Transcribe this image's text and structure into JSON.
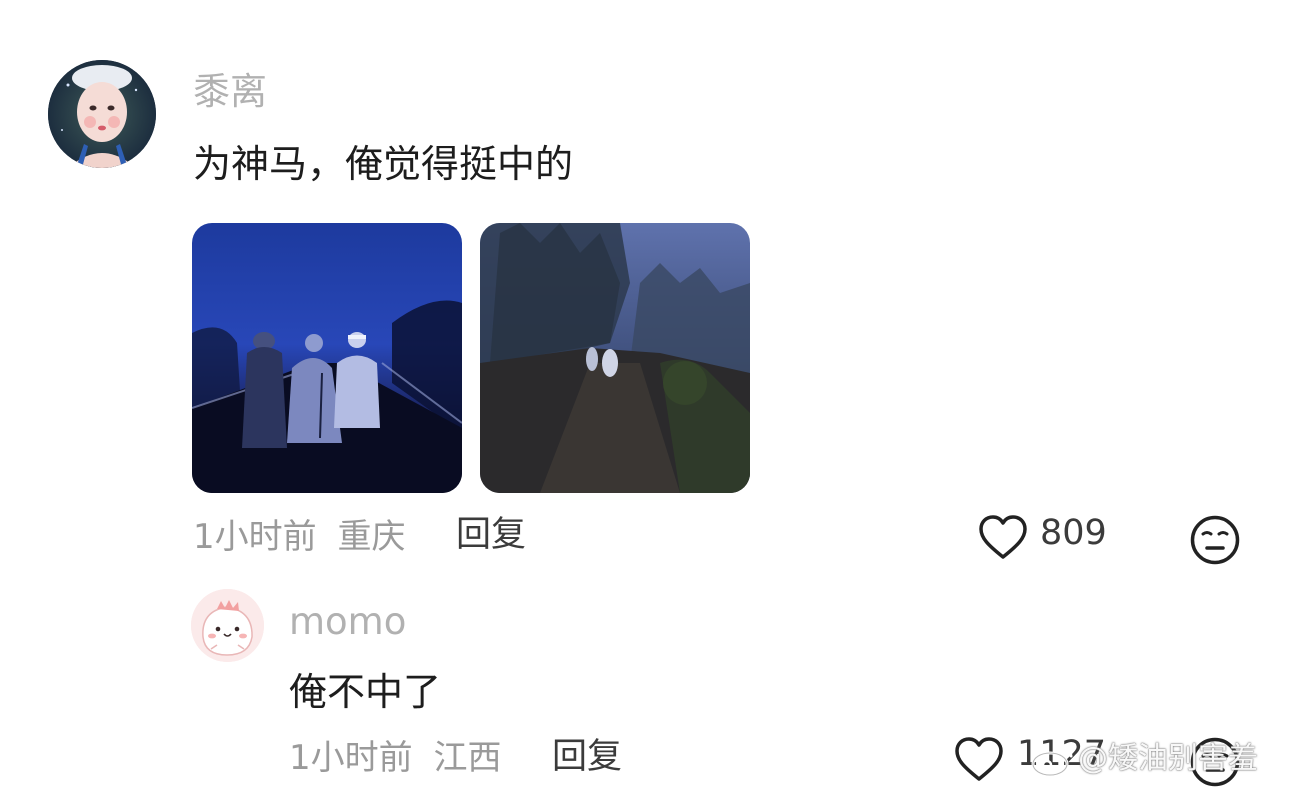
{
  "comments": [
    {
      "username": "黍离",
      "text": "为神马，俺觉得挺中的",
      "time": "1小时前",
      "location": "重庆",
      "reply_label": "回复",
      "likes": "809",
      "images": [
        "photo-foggy-road-people",
        "photo-foggy-mountain-path"
      ]
    }
  ],
  "replies": [
    {
      "username": "momo",
      "text": "俺不中了",
      "time": "1小时前",
      "location": "江西",
      "reply_label": "回复",
      "likes": "1127"
    }
  ],
  "watermark": {
    "handle": "@矮油别害羞"
  },
  "icons": {
    "like": "heart-outline-icon",
    "react": "meh-face-icon",
    "weibo": "weibo-logo-icon"
  },
  "colors": {
    "username": "#b1b1b1",
    "text": "#1d1d1d",
    "meta": "#9a9a9a",
    "action": "#3b3b3b"
  }
}
